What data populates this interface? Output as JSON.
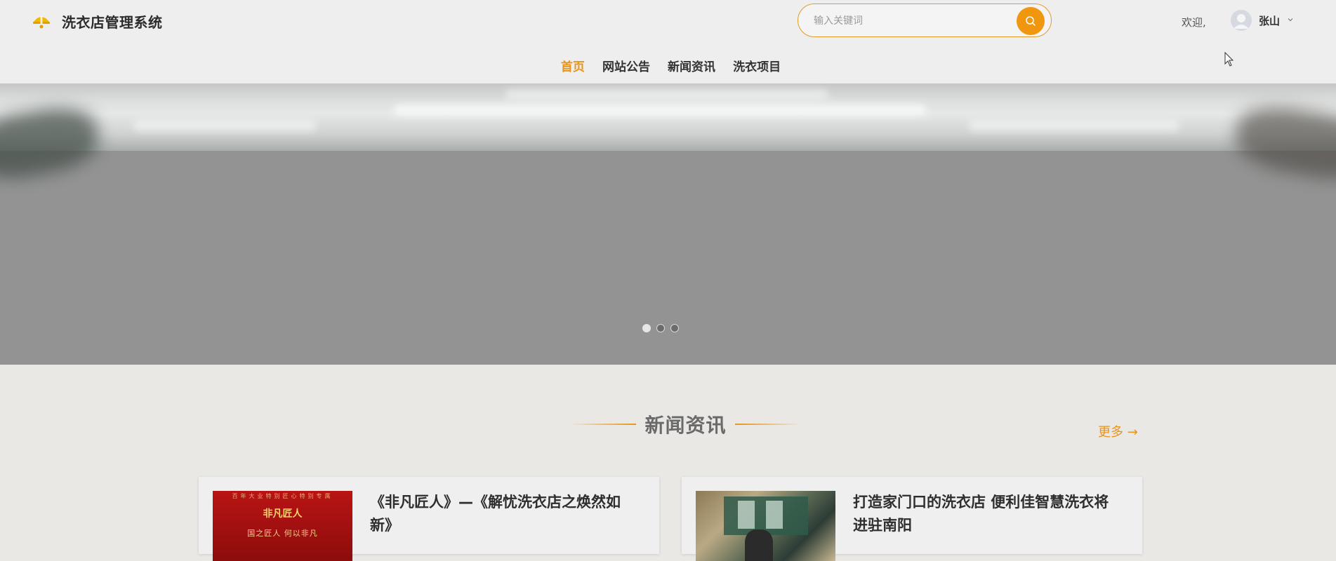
{
  "header": {
    "app_title": "洗衣店管理系统",
    "logo_icon": "laundry-bell-icon",
    "search": {
      "placeholder": "输入关键词",
      "value": ""
    },
    "welcome": "欢迎,",
    "user_name": "张山"
  },
  "nav": {
    "items": [
      {
        "label": "首页",
        "active": true
      },
      {
        "label": "网站公告",
        "active": false
      },
      {
        "label": "新闻资讯",
        "active": false
      },
      {
        "label": "洗衣项目",
        "active": false
      }
    ]
  },
  "banner": {
    "slide_count": 3,
    "active_slide": 1
  },
  "news": {
    "title": "新闻资讯",
    "more": "更多 →",
    "cards": [
      {
        "title": "《非凡匠人》—《解忧洗衣店之焕然如新》",
        "image_text_top": "百年大业特别匠心特别专属",
        "image_text_logo": "非凡匠人",
        "image_text_bottom": "国之匠人 何以非凡"
      },
      {
        "title": "打造家门口的洗衣店 便利佳智慧洗衣将进驻南阳"
      }
    ]
  },
  "colors": {
    "accent": "#e8941a",
    "banner": "#939393",
    "header_bg": "#eeeeee",
    "page_bg": "#eae8e5"
  }
}
